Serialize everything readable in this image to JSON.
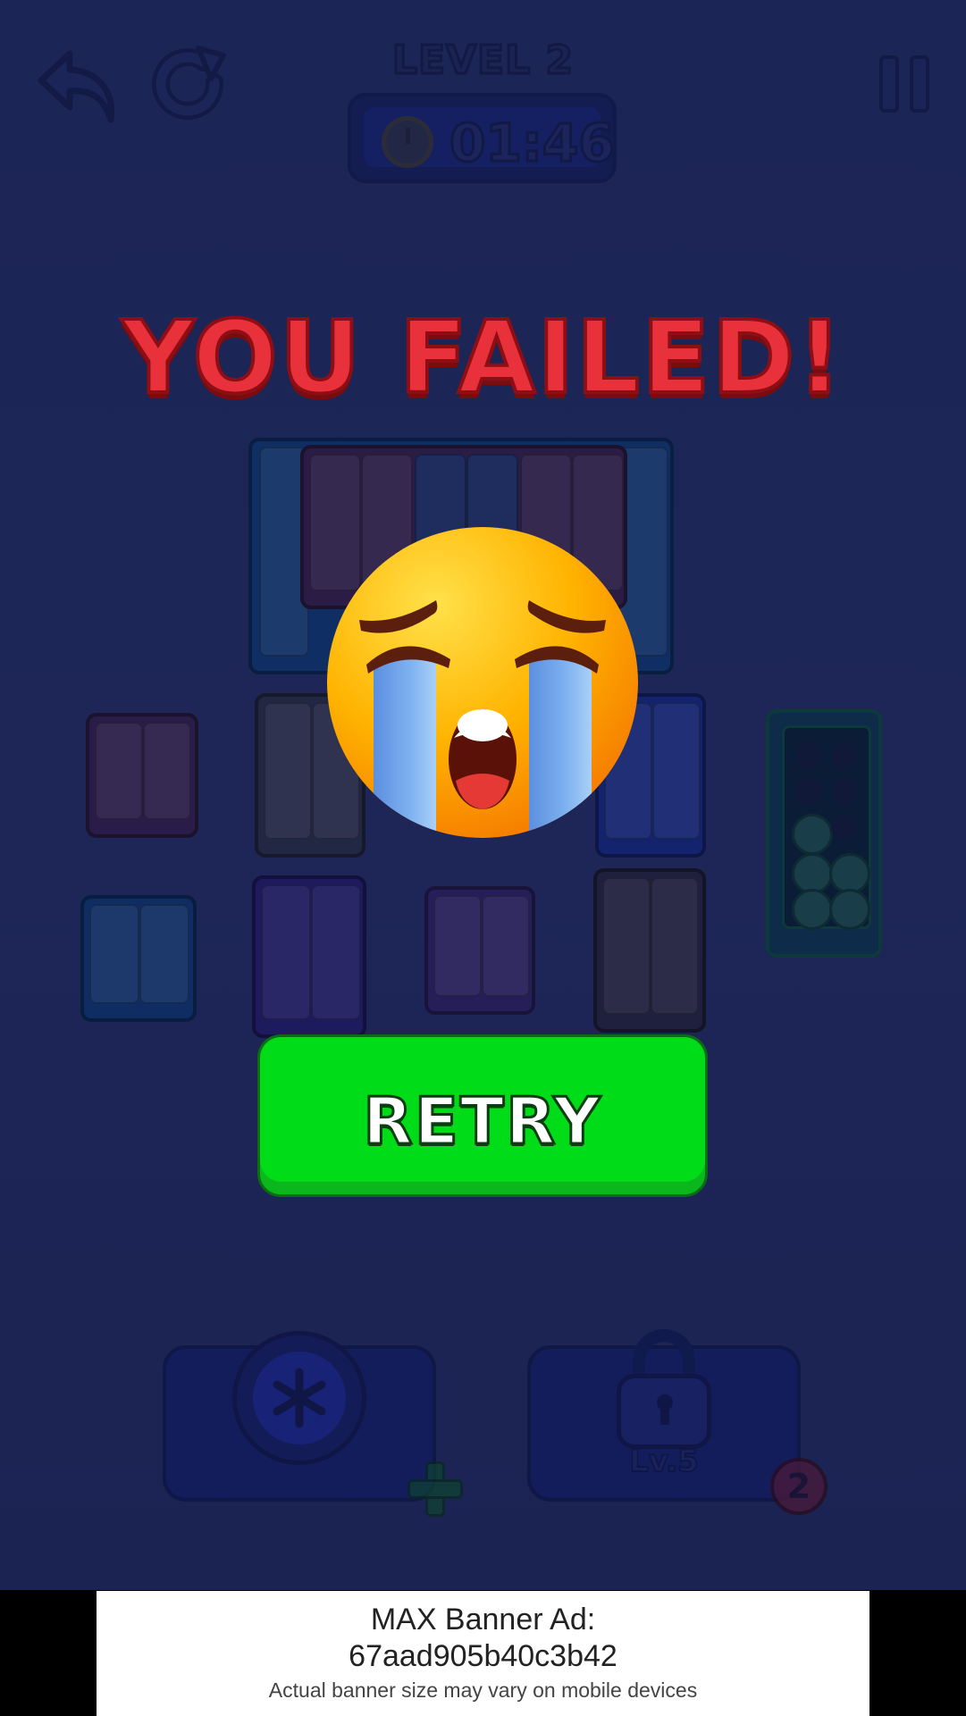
{
  "hud": {
    "level_title": "LEVEL 2",
    "timer": "01:46",
    "icons": [
      "undo-icon",
      "redo-icon",
      "clock-icon",
      "pause-icon"
    ]
  },
  "overlay": {
    "heading": "YOU FAILED!",
    "emoji": "crying-face-icon",
    "retry_label": "RETRY"
  },
  "boosters": {
    "freeze_icon": "snowflake-icon",
    "add_icon": "plus-icon",
    "lock_level": "Lv.5",
    "count_badge": "2"
  },
  "banner_ad": {
    "line1": "MAX Banner Ad:",
    "line2": "67aad905b40c3b42",
    "line3": "Actual banner size may vary on mobile devices"
  },
  "colors": {
    "background": "#1b2556",
    "heading": "#e8313a",
    "retry": "#00dc17",
    "emoji": "#ffc107"
  }
}
